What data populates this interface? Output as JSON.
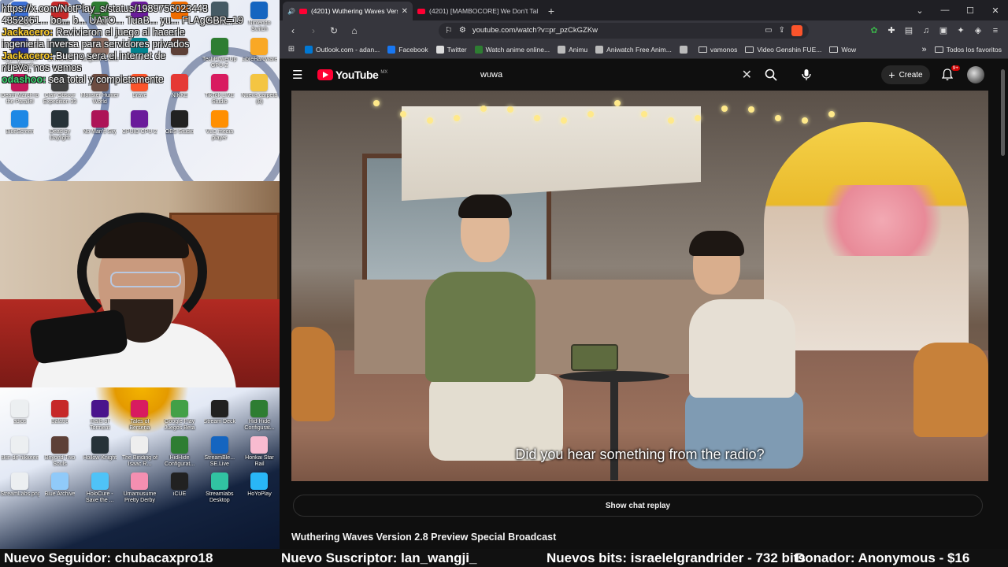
{
  "stream_chat": [
    {
      "user": "",
      "message": "https://x.com/NotPlay_s/status/1989756023443"
    },
    {
      "user": "",
      "message": "4352061... bo... b... UATO... TuaB... yu... FLAgGBR=19"
    },
    {
      "user": "Jackacero:",
      "message": "Revivieron el juego al hacerle"
    },
    {
      "user": "",
      "message": "ingenieria inversa para servidores privados"
    },
    {
      "user": "Jackacero:",
      "message": "Bueno sera el internet de"
    },
    {
      "user": "",
      "message": "nuevo, nos vemos"
    },
    {
      "user": "odashoo:",
      "message": "sea total y completamente"
    }
  ],
  "desktop_top_icons": [
    {
      "label": "NotPlay_s",
      "color": "#3b6fd6"
    },
    {
      "label": "Roulette",
      "color": "#c62828"
    },
    {
      "label": "Waves",
      "color": "#2e7d32"
    },
    {
      "label": "",
      "color": "#6a1b9a"
    },
    {
      "label": "",
      "color": "#ef6c00"
    },
    {
      "label": "Benchmark",
      "color": "#455a64"
    },
    {
      "label": "Nintendo Switch",
      "color": "#1565c0"
    },
    {
      "label": "Superposition Benchmark",
      "color": "#283593"
    },
    {
      "label": "CHRONO",
      "color": "#37474f"
    },
    {
      "label": "Kingdom Come",
      "color": "#8d6e63"
    },
    {
      "label": "",
      "color": "#00838f"
    },
    {
      "label": "",
      "color": "#5d4037"
    },
    {
      "label": "TechPowerUp GPU-Z",
      "color": "#2e7d32"
    },
    {
      "label": "LibreHardware",
      "color": "#f9a825"
    },
    {
      "label": "Death March to the Parallel",
      "color": "#c2185b"
    },
    {
      "label": "Clair Obscur Expedition 33",
      "color": "#424242"
    },
    {
      "label": "Monster Hunter World",
      "color": "#6d4c41"
    },
    {
      "label": "Brave",
      "color": "#fb542b"
    },
    {
      "label": "NIKKE",
      "color": "#e53935"
    },
    {
      "label": "TikTok LIVE Studio",
      "color": "#d81b60"
    },
    {
      "label": "Nueva carpeta (8)",
      "color": "#f4c542"
    },
    {
      "label": "BlueScreen",
      "color": "#1e88e5"
    },
    {
      "label": "Dead by Daylight",
      "color": "#263238"
    },
    {
      "label": "No Man's Sky",
      "color": "#ad1457"
    },
    {
      "label": "CPUID CPU-Z",
      "color": "#6a1b9a"
    },
    {
      "label": "OBS Studio",
      "color": "#212121"
    },
    {
      "label": "VLC media player",
      "color": "#ff8f00"
    }
  ],
  "desktop_bottom_icons": [
    {
      "label": "adios",
      "color": "#eceff1"
    },
    {
      "label": "Balatro",
      "color": "#c62828"
    },
    {
      "label": "Halls of Torment",
      "color": "#4a148c"
    },
    {
      "label": "Tales of Berseria",
      "color": "#d81b60"
    },
    {
      "label": "Google Play Juegos Beta",
      "color": "#43a047"
    },
    {
      "label": "Stream Deck",
      "color": "#212121"
    },
    {
      "label": "Hid-Hide Configurat...",
      "color": "#2e7d32"
    },
    {
      "label": "skin de nikkeee",
      "color": "#eceff1"
    },
    {
      "label": "Beyond Two Souls",
      "color": "#5d4037"
    },
    {
      "label": "Hollow Knight",
      "color": "#263238"
    },
    {
      "label": "The Binding of Isaac R...",
      "color": "#eeeeee"
    },
    {
      "label": "HidHide Configurat...",
      "color": "#2e7d32"
    },
    {
      "label": "StreamBle... SE.Live",
      "color": "#1565c0"
    },
    {
      "label": "Honkai Star Rail",
      "color": "#f8bbd0"
    },
    {
      "label": "StreamLabs.png",
      "color": "#eceff1"
    },
    {
      "label": "Blue Archive",
      "color": "#90caf9"
    },
    {
      "label": "HoloCure - Save the ...",
      "color": "#4fc3f7"
    },
    {
      "label": "Umamusume Pretty Derby",
      "color": "#f48fb1"
    },
    {
      "label": "iCUE",
      "color": "#212121"
    },
    {
      "label": "Streamlabs Desktop",
      "color": "#31c3a2"
    },
    {
      "label": "HoYoPlay",
      "color": "#29b6f6"
    }
  ],
  "ticker": {
    "item1": "Nuevo Seguidor: chubacaxpro18",
    "item2": "Nuevo Suscriptor: lan_wangji_",
    "item3": "Nuevos bits: israelelgrandrider - 732 bits",
    "item4": "Donador: Anonymous - $16"
  },
  "browser": {
    "tabs": [
      {
        "title": "(4201) Wuthering Waves Vers",
        "active": true
      },
      {
        "title": "(4201) [MAMBOCORE] We Don't Talk",
        "active": false
      }
    ],
    "new_tab": "+",
    "url": "youtube.com/watch?v=pr_pzCkGZKw",
    "bookmarks": [
      {
        "label": "Outlook.com - adan...",
        "color": "#0078d4"
      },
      {
        "label": "Facebook",
        "color": "#1877f2"
      },
      {
        "label": "Twitter",
        "color": "#dddddd"
      },
      {
        "label": "Watch anime online...",
        "color": "#2e7d32"
      },
      {
        "label": "Animu",
        "color": "#bbbbbb"
      },
      {
        "label": "Aniwatch Free Anim...",
        "color": "#bbbbbb"
      },
      {
        "label": "",
        "color": "#bbbbbb"
      }
    ],
    "bookmark_folders": [
      "vamonos",
      "Video Genshin FUE...",
      "Wow"
    ],
    "all_bookmarks": "Todos los favoritos"
  },
  "youtube": {
    "logo": "YouTube",
    "country": "MX",
    "search_value": "wuwa",
    "create_label": "Create",
    "notifications": "9+",
    "subtitle": "Did you hear something from the radio?",
    "chat_replay": "Show chat replay",
    "video_title": "Wuthering Waves Version 2.8 Preview Special Broadcast"
  }
}
